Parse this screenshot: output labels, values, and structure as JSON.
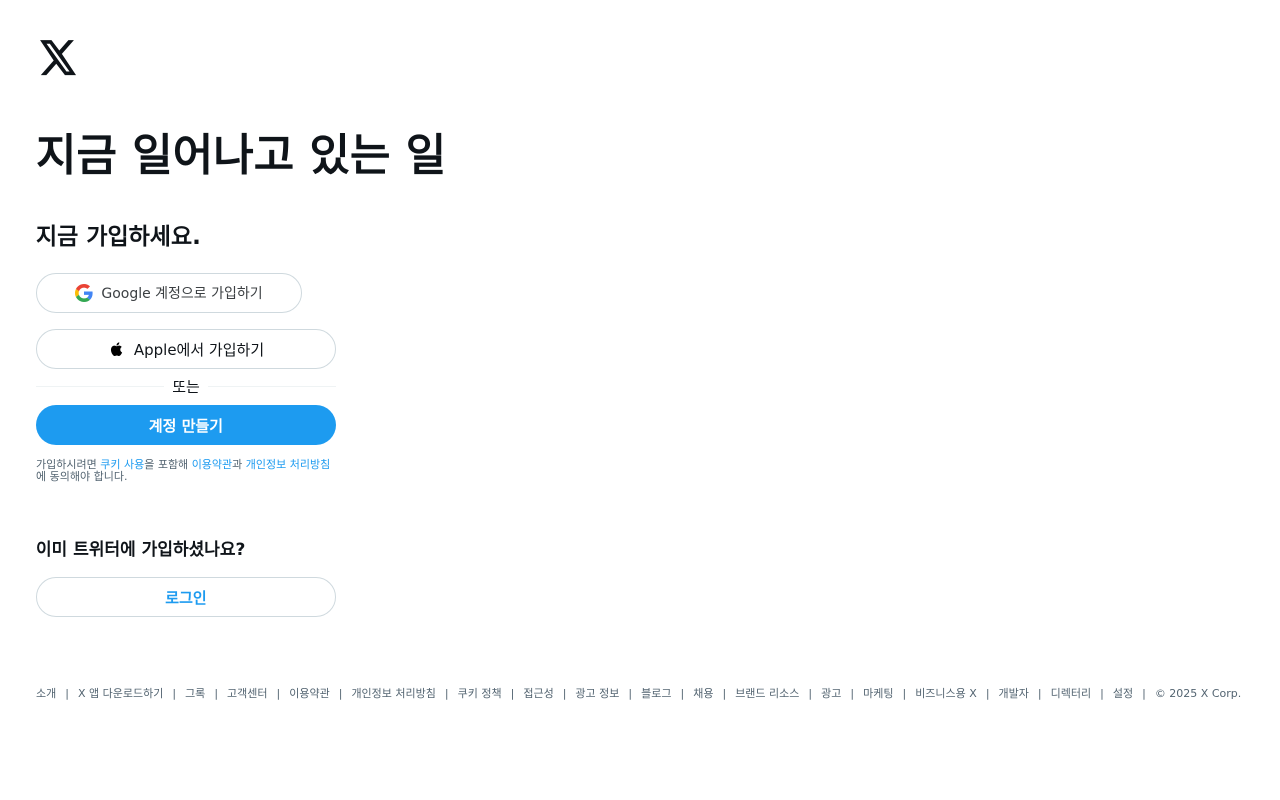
{
  "logo": {
    "icon": "x-logo-icon"
  },
  "headline": "지금 일어나고 있는 일",
  "subhead": "지금 가입하세요.",
  "buttons": {
    "google": {
      "label": "Google 계정으로 가입하기",
      "icon": "google-icon"
    },
    "apple": {
      "label": "Apple에서 가입하기",
      "icon": "apple-icon"
    },
    "create": {
      "label": "계정 만들기"
    },
    "login": {
      "label": "로그인"
    }
  },
  "divider": {
    "label": "또는"
  },
  "legal": {
    "prefix": "가입하시려면 ",
    "cookie_link": "쿠키 사용",
    "mid1": "을 포함해 ",
    "terms_link": "이용약관",
    "mid2": "과 ",
    "privacy_link": "개인정보 처리방침",
    "suffix": "에 동의해야 합니다."
  },
  "already": {
    "title": "이미 트위터에 가입하셨나요?"
  },
  "footer": {
    "links": [
      "소개",
      "X 앱 다운로드하기",
      "그록",
      "고객센터",
      "이용약관",
      "개인정보 처리방침",
      "쿠키 정책",
      "접근성",
      "광고 정보",
      "블로그",
      "채용",
      "브랜드 리소스",
      "광고",
      "마케팅",
      "비즈니스용 X",
      "개발자",
      "디렉터리",
      "설정"
    ],
    "separator": "|",
    "copyright": "© 2025 X Corp."
  },
  "colors": {
    "accent": "#1d9bf0",
    "text": "#0f1419",
    "muted": "#536471",
    "border": "#cfd9de"
  }
}
